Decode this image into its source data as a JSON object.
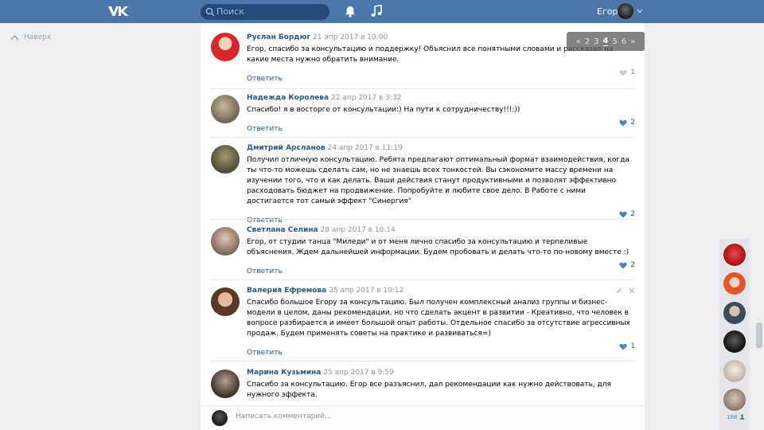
{
  "header": {
    "search_placeholder": "Поиск",
    "username": "Егор"
  },
  "nav": {
    "back_label": "Наверх"
  },
  "pagination": {
    "prev": "«",
    "pages": [
      "2",
      "3",
      "4",
      "5",
      "6"
    ],
    "current": "4",
    "next": "»"
  },
  "comments": [
    {
      "author": "Руслан Бордюг",
      "date": "21 апр 2017 в 10:00",
      "text": "Егор, спасибо за консультацию и поддержку! Объяснил все понятными словами и рассказал на какие места нужно обратить внимание.",
      "reply": "Ответить",
      "likes": "1"
    },
    {
      "author": "Надежда Королева",
      "date": "22 апр 2017 в 3:32",
      "text": "Спасибо! я в восторге от консультации:) На пути к сотрудничеству!!!:))",
      "reply": "Ответить",
      "likes": "2"
    },
    {
      "author": "Дмитрий Арсланов",
      "date": "24 апр 2017 в 11:19",
      "text": "Получил отличную консультацию. Ребята предлагают оптимальный формат взаимодействия, когда ты что-то можешь сделать сам, но не знаешь всех тонкостей. Вы сэкономите массу времени на изучении того, что и как делать. Ваши действия станут продуктивными и позволят эффективно расходовать бюджет на продвижение. Попробуйте и любите свое дело. В Работе с ними достигается тот самый эффект \"Синергия\"",
      "reply": "Ответить",
      "likes": "2"
    },
    {
      "author": "Светлана Селина",
      "date": "28 апр 2017 в 10:14",
      "text": "Егор, от студии танца \"Миледи\" и от меня лично спасибо за консультацию и терпеливые объяснения. Ждем дальнейшей информации. Будем пробовать и делать что-то по-новому вместе :)",
      "reply": "Ответить",
      "likes": "2"
    },
    {
      "author": "Валерия Ефремова",
      "date": "25 апр 2017 в 10:12",
      "text": "Спасибо большое Егору за консультацию. Был получен комплексный анализ группы и бизнес-модели в целом, даны рекомендации, но что сделать акцент в развитии - Креативно, что человек в вопросе разбирается и имеет большой опыт работы. Отдельное спасибо за отсутствие агрессивных продаж. Будем применять советы на практике и развиваться=)",
      "reply": "Ответить",
      "likes": "1"
    },
    {
      "author": "Марина Кузьмина",
      "date": "25 апр 2017 в 9:59",
      "text": "Спасибо за консультацию. Егор все разъяснил, дал рекомендации как нужно действовать, для нужного эффекта.",
      "reply": "Ответить",
      "likes": ""
    }
  ],
  "compose": {
    "placeholder": "Написать комментарий..."
  },
  "chat": {
    "online_count": "188"
  },
  "colors": {
    "header": "#4a76a8",
    "link": "#2a5885",
    "background": "#edeef0"
  },
  "icons": [
    "vk-logo-icon",
    "search-icon",
    "bell-icon",
    "music-icon",
    "chevron-down-icon",
    "arrow-up-icon",
    "heart-icon",
    "edit-icon",
    "close-icon",
    "user-icon"
  ]
}
